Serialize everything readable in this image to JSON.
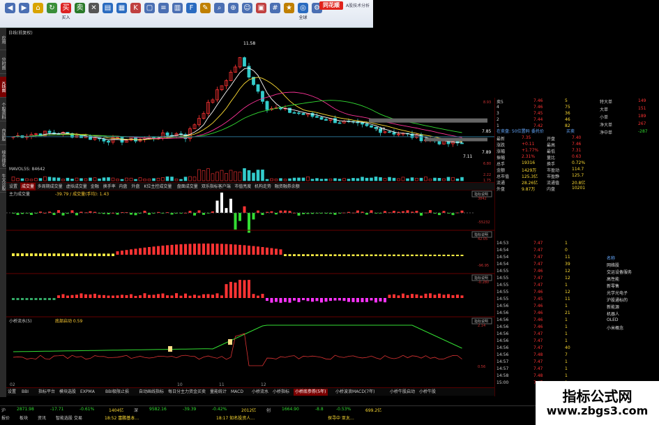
{
  "toolbar": {
    "buttons": [
      {
        "label": "",
        "icon": "back-icon",
        "color": "#4a6fb3"
      },
      {
        "label": "",
        "icon": "forward-icon",
        "color": "#4a6fb3"
      },
      {
        "label": "",
        "icon": "home-icon",
        "color": "#d9a400"
      },
      {
        "label": "",
        "icon": "refresh-icon",
        "color": "#3a8f3a"
      },
      {
        "label": "买入",
        "icon": "buy-icon",
        "color": "#d22"
      },
      {
        "label": "",
        "icon": "sell-icon",
        "color": "#2a7a2a"
      },
      {
        "label": "",
        "icon": "cancel-icon",
        "color": "#555"
      },
      {
        "label": "",
        "icon": "chart-icon",
        "color": "#2a6bc0"
      },
      {
        "label": "",
        "icon": "grid-icon",
        "color": "#2a6bc0"
      },
      {
        "label": "",
        "icon": "kline-icon",
        "color": "#c04040"
      },
      {
        "label": "",
        "icon": "window-icon",
        "color": "#4a6fb3"
      },
      {
        "label": "",
        "icon": "list-icon",
        "color": "#4a6fb3"
      },
      {
        "label": "",
        "icon": "bar-icon",
        "color": "#4a6fb3"
      },
      {
        "label": "",
        "icon": "f10-icon",
        "color": "#2a6bc0"
      },
      {
        "label": "",
        "icon": "pencil-icon",
        "color": "#c08000"
      },
      {
        "label": "",
        "icon": "search-icon",
        "color": "#4a6fb3"
      },
      {
        "label": "",
        "icon": "zoom-icon",
        "color": "#4a6fb3"
      },
      {
        "label": "",
        "icon": "user-icon",
        "color": "#4a6fb3"
      },
      {
        "label": "",
        "icon": "news-icon",
        "color": "#c04040"
      },
      {
        "label": "",
        "icon": "calc-icon",
        "color": "#4a6fb3"
      },
      {
        "label": "",
        "icon": "star-icon",
        "color": "#c08000"
      },
      {
        "label": "全球",
        "icon": "globe-icon",
        "color": "#2a6bc0"
      },
      {
        "label": "",
        "icon": "settings-icon",
        "color": "#4a6fb3"
      }
    ],
    "logo_text": "同花顺",
    "app_title": "A股技术分析"
  },
  "left_tabs": [
    "应用",
    "分时图",
    "K线图",
    "个股资料",
    "自选股",
    "综合排名",
    "牛叉诊股"
  ],
  "main_chart": {
    "header_left": "日线(前复权)",
    "header_mid": "7.30",
    "high_label": "11.58",
    "low_label": "7.11",
    "right_price": "7.85",
    "right_price2": "7.89",
    "mid_level": "7.30",
    "axis": [
      "8.93",
      "6.80",
      "2.22",
      "1.75"
    ],
    "volume_label": "MAVOL5S: 84642"
  },
  "mid_tabs": [
    "设置",
    "成交量",
    "多周期成交量",
    "虚拟成交量",
    "金融",
    "换手率",
    "内盘",
    "外盘",
    "K位主控成交量",
    "盘面成交量",
    "双乐指标客户端",
    "市值亮度",
    "机构走势",
    "融资融券余额"
  ],
  "panels": [
    {
      "title": "主力成交量",
      "vals": "-39.79 / 成交量(手均): 1.43",
      "btn": "指标说明",
      "axis": [
        "3842",
        "-55232"
      ]
    },
    {
      "title": "",
      "vals": "",
      "btn": "指标说明",
      "axis": [
        "42.05",
        "-96.95"
      ]
    },
    {
      "title": "",
      "vals": "",
      "btn": "指标说明",
      "axis": [
        "-0.280"
      ]
    },
    {
      "title": "小桥流水(5)",
      "vals": "底部启动 0.59",
      "btn": "指标说明",
      "axis": [
        "2.14",
        "0.56"
      ]
    }
  ],
  "bottom_tabs": [
    "设置",
    "BBI",
    "指标平台",
    "模块选股",
    "EXPMA",
    "BBI极限止损",
    "自动画线指标",
    "每日分主力资金买卖",
    "量能统计",
    "MACD",
    "小桥流水",
    "小桥指标",
    "小桥底参券(5年)",
    "小桥波浪MACD(7年)",
    "小桥牛股启动",
    "小桥牛股"
  ],
  "bottom_ticks": [
    "02",
    "",
    "",
    "",
    "10",
    "11",
    "12"
  ],
  "quote": {
    "name": "",
    "header": [
      "在卖盘: 50位置码",
      "委托价",
      "买卖"
    ],
    "sell": [
      {
        "label": "卖5",
        "price": "7.46",
        "vol": "5"
      },
      {
        "label": "4",
        "price": "7.46",
        "vol": "75"
      },
      {
        "label": "3",
        "price": "7.45",
        "vol": "36"
      },
      {
        "label": "2",
        "price": "7.44",
        "vol": "46"
      },
      {
        "label": "1",
        "price": "7.42",
        "vol": "82"
      }
    ],
    "stats": [
      [
        "最新",
        "7.35",
        "开盘",
        "7.40"
      ],
      [
        "涨跌",
        "+0.11",
        "最高",
        "7.46"
      ],
      [
        "涨幅",
        "+1.77%",
        "最低",
        "7.31"
      ],
      [
        "振幅",
        "2.31%",
        "量比",
        "0.63"
      ],
      [
        "总手",
        "19316",
        "换手",
        "0.72%"
      ],
      [
        "金额",
        "1429万",
        "市盈动",
        "114.7"
      ],
      [
        "总市值",
        "125.3亿",
        "市盈静",
        "125.7"
      ],
      [
        "流通",
        "28.26亿",
        "流通值",
        "20.8亿"
      ],
      [
        "外盘",
        "9.87万",
        "内盘",
        "10201"
      ]
    ],
    "level2": {
      "headers": [
        "特大单",
        "大单",
        "小单",
        "净大单",
        "净中单"
      ],
      "values": [
        "149",
        "151",
        "189",
        "267",
        "-287"
      ]
    },
    "ticks": [
      [
        "14:53",
        "7.47",
        "1"
      ],
      [
        "14:54",
        "7.47",
        "0"
      ],
      [
        "14:54",
        "7.47",
        "11"
      ],
      [
        "14:54",
        "7.47",
        "39"
      ],
      [
        "14:55",
        "7.46",
        "12"
      ],
      [
        "14:55",
        "7.47",
        "12"
      ],
      [
        "14:55",
        "7.47",
        "1"
      ],
      [
        "14:55",
        "7.46",
        "12"
      ],
      [
        "14:55",
        "7.45",
        "11"
      ],
      [
        "14:56",
        "7.46",
        "1"
      ],
      [
        "14:56",
        "7.46",
        "21"
      ],
      [
        "14:56",
        "7.46",
        "1"
      ],
      [
        "14:56",
        "7.46",
        "1"
      ],
      [
        "14:56",
        "7.47",
        "1"
      ],
      [
        "14:56",
        "7.47",
        "1"
      ],
      [
        "14:56",
        "7.47",
        "40"
      ],
      [
        "14:56",
        "7.48",
        "7"
      ],
      [
        "14:57",
        "7.47",
        "1"
      ],
      [
        "14:57",
        "7.47",
        "1"
      ],
      [
        "14:58",
        "7.48",
        "1"
      ],
      [
        "15:00",
        "7.47",
        "1"
      ]
    ],
    "concepts": [
      "名称",
      "网络股",
      "交运设备服务",
      "高性能",
      "新零售",
      "光学光电子",
      "沪股通标的",
      "新能源",
      "机器人",
      "OLED",
      "小米概念"
    ]
  },
  "status": {
    "row1": [
      "沪",
      "2871.98",
      "-17.71",
      "-0.61%",
      "1404亿",
      "深",
      "9582.16",
      "-39.39",
      "-0.42%",
      "2012亿",
      "创",
      "1664.90",
      "-8.8",
      "-0.53%",
      "699.2亿"
    ],
    "row2": [
      "18:52 富鹏基本…",
      "18:17 知名投资人…",
      "探寻中 亚太…"
    ],
    "row3": [
      "报价",
      "板块",
      "资讯",
      "智能选股",
      "交易"
    ]
  },
  "watermark": {
    "title": "指标公式网",
    "url": "www.zbgs3.com"
  },
  "colors": {
    "up": "#ff3333",
    "down": "#33dd33",
    "yellow": "#ffee44",
    "magenta": "#ff33ff",
    "cyan": "#33cccc"
  }
}
